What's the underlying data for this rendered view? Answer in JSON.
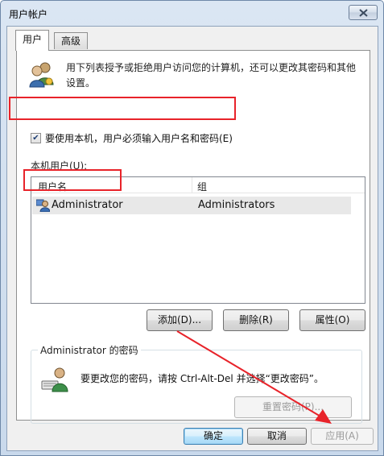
{
  "window": {
    "title": "用户帐户"
  },
  "tabs": [
    {
      "label": "用户"
    },
    {
      "label": "高级"
    }
  ],
  "users_tab": {
    "description": "用下列表授予或拒绝用户访问您的计算机，还可以更改其密码和其他设置。",
    "require_login_label": "要使用本机，用户必须输入用户名和密码(E)",
    "require_login_checked": true,
    "local_users_label": "本机用户(U):",
    "columns": [
      "用户名",
      "组"
    ],
    "rows": [
      {
        "username": "Administrator",
        "group": "Administrators"
      }
    ],
    "buttons": {
      "add": "添加(D)...",
      "remove": "删除(R)",
      "properties": "属性(O)"
    },
    "password_group": {
      "title": "Administrator 的密码",
      "text": "要更改您的密码，请按 Ctrl-Alt-Del 并选择“更改密码”。",
      "reset_button": "重置密码(P)..."
    }
  },
  "footer": {
    "ok": "确定",
    "cancel": "取消",
    "apply": "应用(A)"
  },
  "icons": {
    "close": "close-icon",
    "users": "users-icon",
    "user": "user-icon",
    "keyboard_user": "keyboard-user-icon",
    "checkmark": "checkmark-icon"
  },
  "colors": {
    "annotation_red": "#e8232a",
    "selection": "#e8e8e8",
    "default_button": "#3c7fb1"
  }
}
